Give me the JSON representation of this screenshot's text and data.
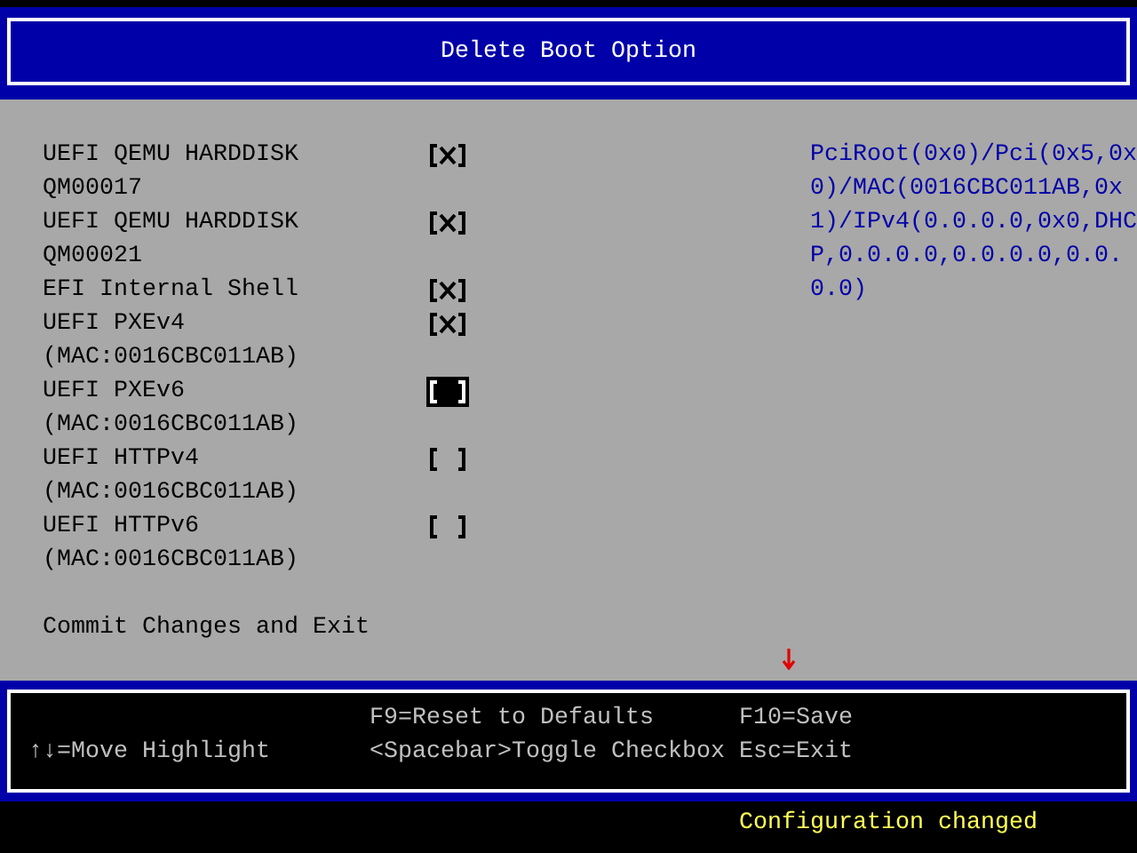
{
  "window": {
    "title": "Delete Boot Option"
  },
  "options": [
    {
      "label": "UEFI QEMU HARDDISK QM00017",
      "checked": true,
      "selected": false
    },
    {
      "label": "UEFI QEMU HARDDISK QM00021",
      "checked": true,
      "selected": false
    },
    {
      "label": "EFI Internal Shell",
      "checked": true,
      "selected": false
    },
    {
      "label": "UEFI PXEv4 (MAC:0016CBC011AB)",
      "checked": true,
      "selected": false
    },
    {
      "label": "UEFI PXEv6 (MAC:0016CBC011AB)",
      "checked": false,
      "selected": true
    },
    {
      "label": "UEFI HTTPv4 (MAC:0016CBC011AB)",
      "checked": false,
      "selected": false
    },
    {
      "label": "UEFI HTTPv6 (MAC:0016CBC011AB)",
      "checked": false,
      "selected": false
    }
  ],
  "commit": {
    "label": "Commit Changes and Exit"
  },
  "help_text": "PciRoot(0x0)/Pci(0x5,0x0)/MAC(0016CBC011AB,0x1)/IPv4(0.0.0.0,0x0,DHCP,0.0.0.0,0.0.0.0,0.0.0.0)",
  "key_help": [
    {
      "lines": [
        "↑↓=Move Highlight"
      ]
    },
    {
      "lines": [
        "F9=Reset to Defaults",
        "<Spacebar>Toggle Checkbox"
      ]
    },
    {
      "lines": [
        "F10=Save",
        "Esc=Exit"
      ]
    }
  ],
  "status_bar": {
    "message": "Configuration changed"
  }
}
